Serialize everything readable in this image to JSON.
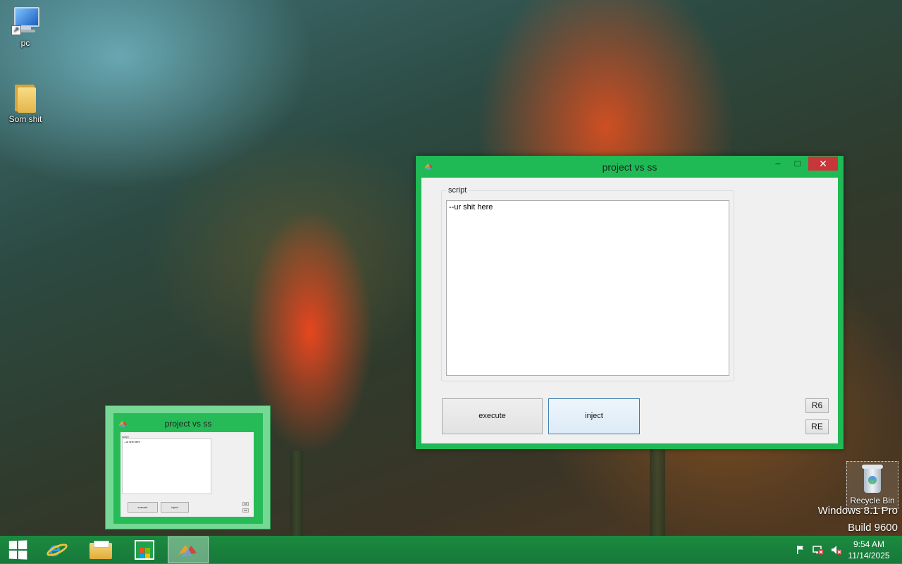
{
  "desktop": {
    "icons": [
      {
        "label": "pc",
        "icon": "computer-icon"
      },
      {
        "label": "Som shit",
        "icon": "folder-icon"
      }
    ],
    "recycle_bin": {
      "label": "Recycle Bin",
      "icon": "recycle-bin-icon"
    },
    "watermark": {
      "line1": "Windows 8.1 Pro",
      "line2": "Build 9600"
    }
  },
  "window": {
    "title": "project vs ss",
    "controls": {
      "minimize": "–",
      "maximize": "□",
      "close": "✕"
    },
    "groupbox_label": "script",
    "script_text": "--ur shit here",
    "buttons": {
      "execute": "execute",
      "inject": "inject",
      "r6": "R6",
      "re": "RE"
    },
    "accent_color": "#1fba55"
  },
  "thumbnail": {
    "title": "project vs ss",
    "groupbox_label": "script",
    "script_text": "--ur shit here",
    "buttons": {
      "execute": "execute",
      "inject": "inject",
      "r6": "R6",
      "re": "RE"
    }
  },
  "taskbar": {
    "items": [
      {
        "name": "start-button",
        "icon": "windows-logo-icon"
      },
      {
        "name": "internet-explorer",
        "icon": "ie-icon"
      },
      {
        "name": "file-explorer",
        "icon": "folder-icon"
      },
      {
        "name": "store",
        "icon": "store-icon"
      },
      {
        "name": "project-vs-ss",
        "icon": "app-icon",
        "active": true
      }
    ],
    "tray_icons": [
      "flag-icon",
      "network-icon",
      "volume-muted-icon"
    ],
    "clock": {
      "time": "9:54 AM",
      "date": "11/14/2025"
    }
  }
}
